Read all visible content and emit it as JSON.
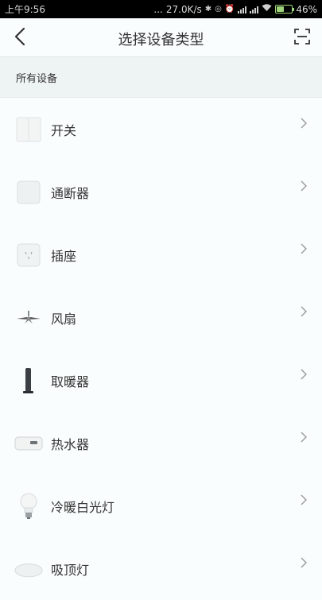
{
  "status_bar": {
    "time": "上午9:56",
    "dots": "...",
    "speed": "27.0K/s",
    "battery_percent": "46%",
    "battery_level": 0.46
  },
  "nav": {
    "title": "选择设备类型"
  },
  "section": {
    "label": "所有设备"
  },
  "devices": [
    {
      "label": "开关",
      "icon": "wall-switch-icon"
    },
    {
      "label": "通断器",
      "icon": "relay-icon"
    },
    {
      "label": "插座",
      "icon": "socket-icon"
    },
    {
      "label": "风扇",
      "icon": "ceiling-fan-icon"
    },
    {
      "label": "取暖器",
      "icon": "tower-heater-icon"
    },
    {
      "label": "热水器",
      "icon": "water-heater-icon"
    },
    {
      "label": "冷暖白光灯",
      "icon": "bulb-icon"
    },
    {
      "label": "吸顶灯",
      "icon": "ceiling-light-icon"
    }
  ],
  "colors": {
    "background": "#f9fdfd",
    "section_bg": "#eef3f3",
    "text": "#333333",
    "chevron": "#9a9a9a",
    "status_bar": "#000000",
    "battery": "#9fd47a"
  }
}
